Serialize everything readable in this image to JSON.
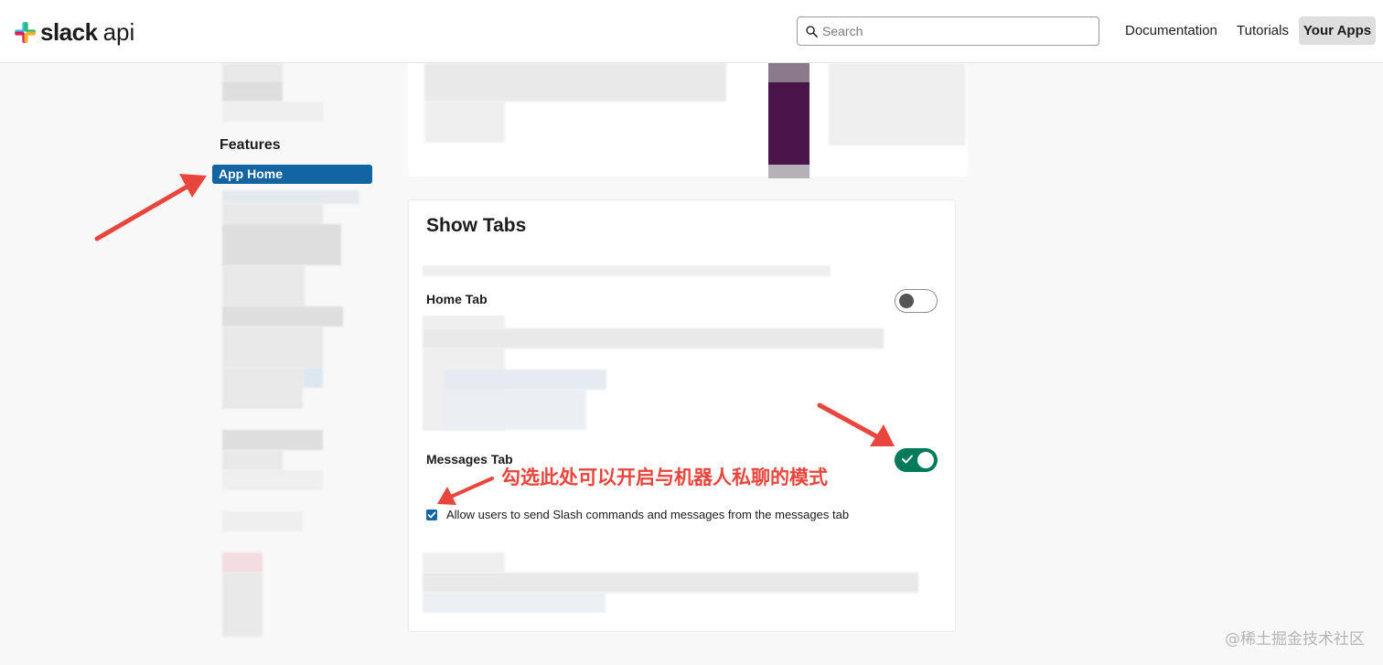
{
  "header": {
    "logo_word": "slack",
    "logo_suffix": "api",
    "search_placeholder": "Search",
    "nav": {
      "documentation": "Documentation",
      "tutorials": "Tutorials",
      "your_apps": "Your Apps"
    }
  },
  "sidebar": {
    "section_heading": "Features",
    "active_item": "App Home"
  },
  "main": {
    "card_title": "Show Tabs",
    "home_tab": {
      "label": "Home Tab",
      "enabled": false
    },
    "messages_tab": {
      "label": "Messages Tab",
      "enabled": true
    },
    "checkbox": {
      "label": "Allow users to send Slash commands and messages from the messages tab",
      "checked": true
    }
  },
  "annotation": {
    "text": "勾选此处可以开启与机器人私聊的模式",
    "color": "#e8453c"
  },
  "watermark": "@稀土掘金技术社区",
  "colors": {
    "active_blue": "#1264a3",
    "toggle_green": "#007a5a",
    "brand_purple": "#4a154b"
  }
}
